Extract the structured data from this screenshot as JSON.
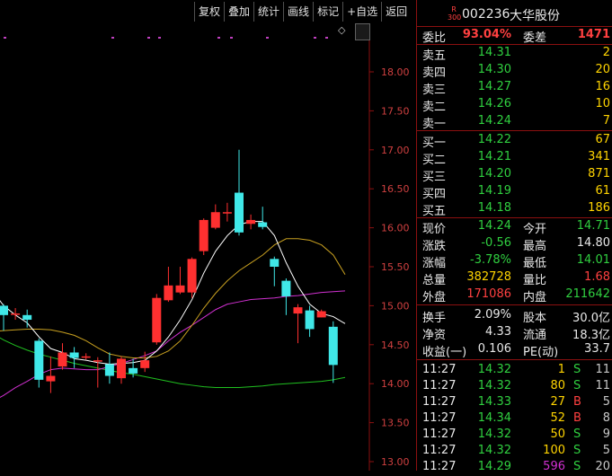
{
  "toolbar": {
    "buttons": [
      {
        "name": "fuquan-button",
        "label": "复权"
      },
      {
        "name": "diejia-button",
        "label": "叠加"
      },
      {
        "name": "tongji-button",
        "label": "统计"
      },
      {
        "name": "huaxian-button",
        "label": "画线"
      },
      {
        "name": "biaoji-button",
        "label": "标记"
      },
      {
        "name": "add-watchlist-button",
        "label": "+自选"
      },
      {
        "name": "back-button",
        "label": "返回"
      }
    ]
  },
  "chart_data": {
    "type": "candlestick",
    "yticks": [
      "18.00",
      "17.50",
      "17.00",
      "16.50",
      "16.00",
      "15.50",
      "15.00",
      "14.50",
      "14.00",
      "13.50",
      "13.00"
    ],
    "ylim": [
      13.0,
      18.0
    ],
    "candles": [
      {
        "o": 15.0,
        "c": 14.88,
        "h": 15.02,
        "l": 14.68
      },
      {
        "o": 14.9,
        "c": 14.9,
        "h": 14.97,
        "l": 14.82
      },
      {
        "o": 14.88,
        "c": 14.82,
        "h": 14.95,
        "l": 14.72
      },
      {
        "o": 14.55,
        "c": 14.05,
        "h": 14.58,
        "l": 13.95
      },
      {
        "o": 14.03,
        "c": 14.1,
        "h": 14.35,
        "l": 13.88
      },
      {
        "o": 14.22,
        "c": 14.4,
        "h": 14.52,
        "l": 14.18
      },
      {
        "o": 14.4,
        "c": 14.33,
        "h": 14.47,
        "l": 14.2
      },
      {
        "o": 14.35,
        "c": 14.35,
        "h": 14.39,
        "l": 14.31
      },
      {
        "o": 14.3,
        "c": 14.3,
        "h": 14.34,
        "l": 13.95
      },
      {
        "o": 14.25,
        "c": 14.1,
        "h": 14.4,
        "l": 14.0
      },
      {
        "o": 14.07,
        "c": 14.32,
        "h": 14.35,
        "l": 14.0
      },
      {
        "o": 14.2,
        "c": 14.13,
        "h": 14.32,
        "l": 14.08
      },
      {
        "o": 14.2,
        "c": 14.3,
        "h": 14.41,
        "l": 14.15
      },
      {
        "o": 14.53,
        "c": 15.1,
        "h": 15.15,
        "l": 14.5
      },
      {
        "o": 15.07,
        "c": 15.26,
        "h": 15.5,
        "l": 15.05
      },
      {
        "o": 15.17,
        "c": 15.26,
        "h": 15.5,
        "l": 15.15
      },
      {
        "o": 15.17,
        "c": 15.6,
        "h": 15.62,
        "l": 15.1
      },
      {
        "o": 15.7,
        "c": 16.1,
        "h": 16.12,
        "l": 15.65
      },
      {
        "o": 16.0,
        "c": 16.2,
        "h": 16.3,
        "l": 15.98
      },
      {
        "o": 16.2,
        "c": 16.2,
        "h": 16.32,
        "l": 16.08
      },
      {
        "o": 16.45,
        "c": 15.94,
        "h": 17.0,
        "l": 15.9
      },
      {
        "o": 16.05,
        "c": 16.1,
        "h": 16.17,
        "l": 15.98
      },
      {
        "o": 16.07,
        "c": 16.01,
        "h": 16.27,
        "l": 15.98
      },
      {
        "o": 15.6,
        "c": 15.5,
        "h": 15.63,
        "l": 15.25
      },
      {
        "o": 15.32,
        "c": 15.12,
        "h": 15.35,
        "l": 14.88
      },
      {
        "o": 14.9,
        "c": 14.98,
        "h": 15.02,
        "l": 14.52
      },
      {
        "o": 14.94,
        "c": 14.7,
        "h": 15.0,
        "l": 14.6
      },
      {
        "o": 14.85,
        "c": 14.93,
        "h": 14.95,
        "l": 14.85
      },
      {
        "o": 14.73,
        "c": 14.24,
        "h": 14.8,
        "l": 14.01
      }
    ],
    "ma_white": [
      15.2,
      15.0,
      14.88,
      14.78,
      14.6,
      14.45,
      14.4,
      14.32,
      14.3,
      14.27,
      14.25,
      14.26,
      14.27,
      14.3,
      14.42,
      14.6,
      14.82,
      15.08,
      15.42,
      15.7,
      15.9,
      16.04,
      16.08,
      16.08,
      15.9,
      15.55,
      15.25,
      15.02,
      14.9,
      14.86,
      14.77
    ],
    "ma_yellow": [
      14.67,
      14.68,
      14.69,
      14.7,
      14.7,
      14.69,
      14.66,
      14.62,
      14.55,
      14.46,
      14.38,
      14.35,
      14.33,
      14.33,
      14.35,
      14.42,
      14.55,
      14.75,
      14.97,
      15.16,
      15.32,
      15.45,
      15.55,
      15.65,
      15.78,
      15.86,
      15.86,
      15.84,
      15.78,
      15.65,
      15.4
    ],
    "ma_magenta": [
      13.77,
      13.85,
      13.95,
      14.03,
      14.12,
      14.18,
      14.2,
      14.19,
      14.18,
      14.18,
      14.22,
      14.26,
      14.31,
      14.36,
      14.42,
      14.55,
      14.66,
      14.75,
      14.85,
      14.95,
      15.02,
      15.05,
      15.08,
      15.09,
      15.1,
      15.12,
      15.13,
      15.15,
      15.17,
      15.18,
      15.19
    ],
    "ma_green": [
      14.65,
      14.56,
      14.49,
      14.43,
      14.38,
      14.34,
      14.3,
      14.26,
      14.23,
      14.2,
      14.17,
      14.14,
      14.12,
      14.09,
      14.06,
      14.03,
      14.0,
      13.98,
      13.96,
      13.95,
      13.95,
      13.95,
      13.96,
      13.97,
      13.99,
      14.0,
      14.01,
      14.02,
      14.03,
      14.05,
      14.08
    ]
  },
  "quote": {
    "market_tag_top": "R",
    "market_tag_bottom": "300",
    "code": "002236",
    "name": "大华股份",
    "weibi_label": "委比",
    "weibi_value": "93.04%",
    "weicha_label": "委差",
    "weicha_value": "1471",
    "asks": [
      {
        "label": "卖五",
        "price": "14.31",
        "vol": "2"
      },
      {
        "label": "卖四",
        "price": "14.30",
        "vol": "20"
      },
      {
        "label": "卖三",
        "price": "14.27",
        "vol": "16"
      },
      {
        "label": "卖二",
        "price": "14.26",
        "vol": "10"
      },
      {
        "label": "卖一",
        "price": "14.24",
        "vol": "7"
      }
    ],
    "bids": [
      {
        "label": "买一",
        "price": "14.22",
        "vol": "67"
      },
      {
        "label": "买二",
        "price": "14.21",
        "vol": "341"
      },
      {
        "label": "买三",
        "price": "14.20",
        "vol": "871"
      },
      {
        "label": "买四",
        "price": "14.19",
        "vol": "61"
      },
      {
        "label": "买五",
        "price": "14.18",
        "vol": "186"
      }
    ],
    "stats1": [
      {
        "l1": "现价",
        "v1": "14.24",
        "c1": "green",
        "l2": "今开",
        "v2": "14.71",
        "c2": "green"
      },
      {
        "l1": "涨跌",
        "v1": "-0.56",
        "c1": "green",
        "l2": "最高",
        "v2": "14.80",
        "c2": "white"
      },
      {
        "l1": "涨幅",
        "v1": "-3.78%",
        "c1": "green",
        "l2": "最低",
        "v2": "14.01",
        "c2": "green"
      },
      {
        "l1": "总量",
        "v1": "382728",
        "c1": "yellow",
        "l2": "量比",
        "v2": "1.68",
        "c2": "red"
      },
      {
        "l1": "外盘",
        "v1": "171086",
        "c1": "red",
        "l2": "内盘",
        "v2": "211642",
        "c2": "green"
      }
    ],
    "stats2": [
      {
        "l1": "换手",
        "v1": "2.09%",
        "l2": "股本",
        "v2": "30.0亿"
      },
      {
        "l1": "净资",
        "v1": "4.33",
        "l2": "流通",
        "v2": "18.3亿"
      },
      {
        "l1": "收益(一)",
        "v1": "0.106",
        "l2": "PE(动)",
        "v2": "33.7"
      }
    ],
    "ticks": [
      {
        "time": "11:27",
        "price": "14.32",
        "vol": "1",
        "flag": "S",
        "fc": "green",
        "cnt": "11"
      },
      {
        "time": "11:27",
        "price": "14.32",
        "vol": "80",
        "flag": "S",
        "fc": "green",
        "cnt": "11"
      },
      {
        "time": "11:27",
        "price": "14.33",
        "vol": "27",
        "flag": "B",
        "fc": "red",
        "cnt": "5"
      },
      {
        "time": "11:27",
        "price": "14.34",
        "vol": "52",
        "flag": "B",
        "fc": "red",
        "cnt": "8"
      },
      {
        "time": "11:27",
        "price": "14.32",
        "vol": "50",
        "flag": "S",
        "fc": "green",
        "cnt": "9"
      },
      {
        "time": "11:27",
        "price": "14.32",
        "vol": "100",
        "flag": "S",
        "fc": "green",
        "cnt": "5"
      },
      {
        "time": "11:27",
        "price": "14.29",
        "vol": "596",
        "flag": "S",
        "fc": "green",
        "cnt": "20"
      }
    ]
  }
}
